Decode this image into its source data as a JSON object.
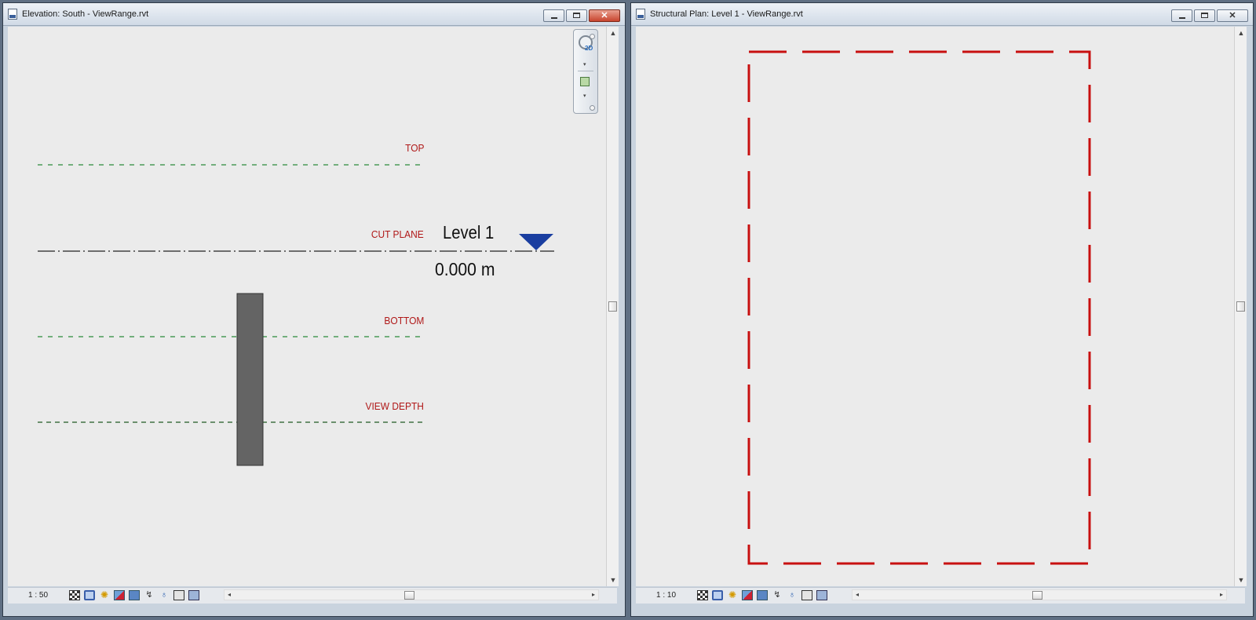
{
  "left_window": {
    "title": "Elevation: South - ViewRange.rvt",
    "scale": "1 : 50",
    "view_range": {
      "top": "TOP",
      "cut_plane": "CUT PLANE",
      "bottom": "BOTTOM",
      "view_depth": "VIEW DEPTH"
    },
    "level": {
      "name": "Level 1",
      "elevation": "0.000 m",
      "marker_color": "#1a3ea0"
    },
    "colors": {
      "label": "#b01818",
      "range_line": "#2a8a3a",
      "depth_line": "#1f5a22",
      "column": "#646464"
    }
  },
  "right_window": {
    "title": "Structural Plan: Level 1 - ViewRange.rvt",
    "scale": "1 : 10",
    "colors": {
      "outline": "#c81010"
    }
  },
  "icons": {
    "document": "revit-document-icon",
    "navigation": "steering-wheel-2d-icon",
    "zoom": "zoom-region-icon"
  }
}
